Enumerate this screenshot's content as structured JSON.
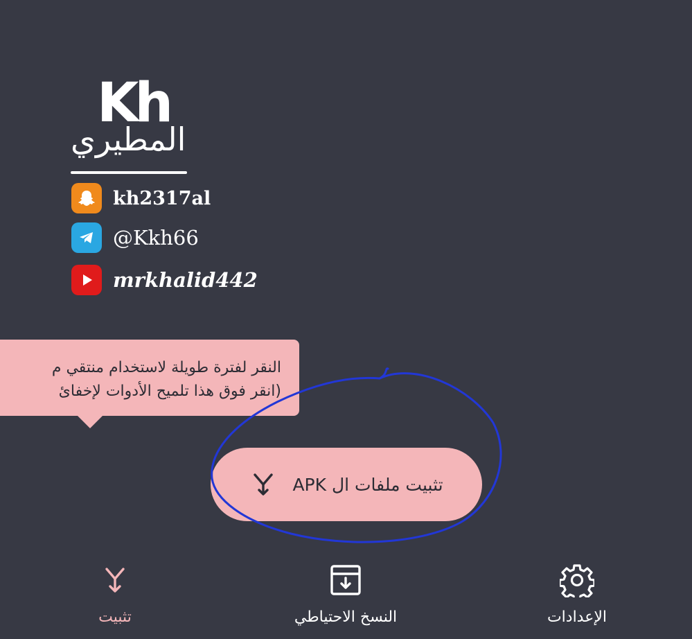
{
  "branding": {
    "logo_latin": "Kh",
    "logo_arabic": "المطيري"
  },
  "social": {
    "snapchat": "kh2317al",
    "telegram": "@Kkh66",
    "youtube": "mrkhalid442"
  },
  "tooltip": {
    "line1": "النقر لفترة طويلة لاستخدام منتقي م",
    "line2": "(انقر فوق هذا تلميح الأدوات لإخفائ"
  },
  "fab": {
    "label": "تثبيت ملفات ال APK"
  },
  "nav": {
    "install": "تثبيت",
    "backup": "النسخ الاحتياطي",
    "settings": "الإعدادات"
  },
  "colors": {
    "background": "#373944",
    "accent_pink": "#f4b6b9",
    "annotation_blue": "#2237d6",
    "snapchat": "#f08a1c",
    "telegram": "#2aa7e2",
    "youtube": "#e01b1b"
  },
  "icons": {
    "fab": "merge-arrow-down-icon",
    "install": "merge-arrow-down-icon",
    "backup": "archive-download-icon",
    "settings": "gear-icon"
  }
}
